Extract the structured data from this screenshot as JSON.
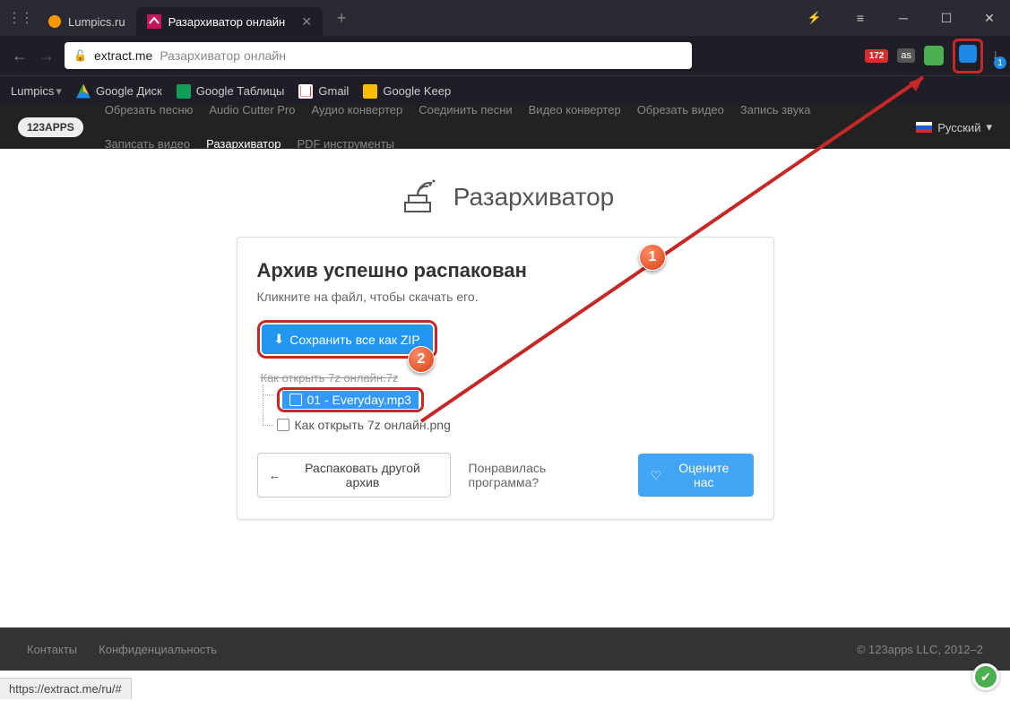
{
  "titlebar": {
    "tabs": [
      {
        "label": "Lumpics.ru"
      },
      {
        "label": "Разархиватор онлайн"
      }
    ]
  },
  "addressbar": {
    "domain": "extract.me",
    "title": "Разархиватор онлайн",
    "badge_red": "172",
    "download_count": "1"
  },
  "bookmarks": [
    "Lumpics",
    "Google Диск",
    "Google Таблицы",
    "Gmail",
    "Google Keep"
  ],
  "appnav": {
    "logo": "123APPS",
    "links": [
      "Обрезать песню",
      "Audio Cutter Pro",
      "Аудио конвертер",
      "Соединить песни",
      "Видео конвертер",
      "Обрезать видео",
      "Запись звука",
      "Записать видео",
      "Разархиватор",
      "PDF инструменты"
    ],
    "active_link": "Разархиватор",
    "lang": "Русский"
  },
  "hero": {
    "title": "Разархиватор"
  },
  "card": {
    "title": "Архив успешно распакован",
    "subtitle": "Кликните на файл, чтобы скачать его.",
    "zip_button": "Сохранить все как ZIP",
    "tree_root": "Как открыть 7z онлайн.7z",
    "files": [
      "01 - Everyday.mp3",
      "Как открыть 7z онлайн.png"
    ],
    "unpack_another": "Распаковать другой архив",
    "like_text": "Понравилась программа?",
    "rate_us": "Оцените нас"
  },
  "footer": {
    "links": [
      "Контакты",
      "Конфиденциальность"
    ],
    "copyright": "© 123apps LLC, 2012–2"
  },
  "statusbar": {
    "url": "https://extract.me/ru/#"
  },
  "annotations": {
    "marker1": "1",
    "marker2": "2"
  }
}
